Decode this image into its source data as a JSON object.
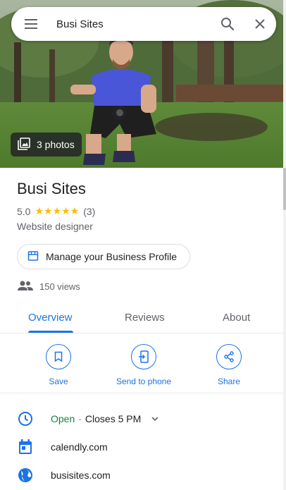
{
  "search": {
    "query": "Busi Sites"
  },
  "hero": {
    "photos_label": "3 photos"
  },
  "place": {
    "title": "Busi Sites",
    "rating": "5.0",
    "stars": "★★★★★",
    "review_count": "(3)",
    "category": "Website designer"
  },
  "manage": {
    "label": "Manage your Business Profile"
  },
  "views": {
    "label": "150 views"
  },
  "tabs": [
    {
      "label": "Overview"
    },
    {
      "label": "Reviews"
    },
    {
      "label": "About"
    }
  ],
  "actions": [
    {
      "label": "Save",
      "icon": "bookmark-icon"
    },
    {
      "label": "Send to phone",
      "icon": "send-to-phone-icon"
    },
    {
      "label": "Share",
      "icon": "share-icon"
    }
  ],
  "hours": {
    "status": "Open",
    "separator": "·",
    "closes": "Closes 5 PM"
  },
  "booking": {
    "label": "calendly.com"
  },
  "website": {
    "label": "busisites.com"
  },
  "colors": {
    "accent": "#1a73e8",
    "open": "#188038",
    "star": "#fbbc04"
  }
}
